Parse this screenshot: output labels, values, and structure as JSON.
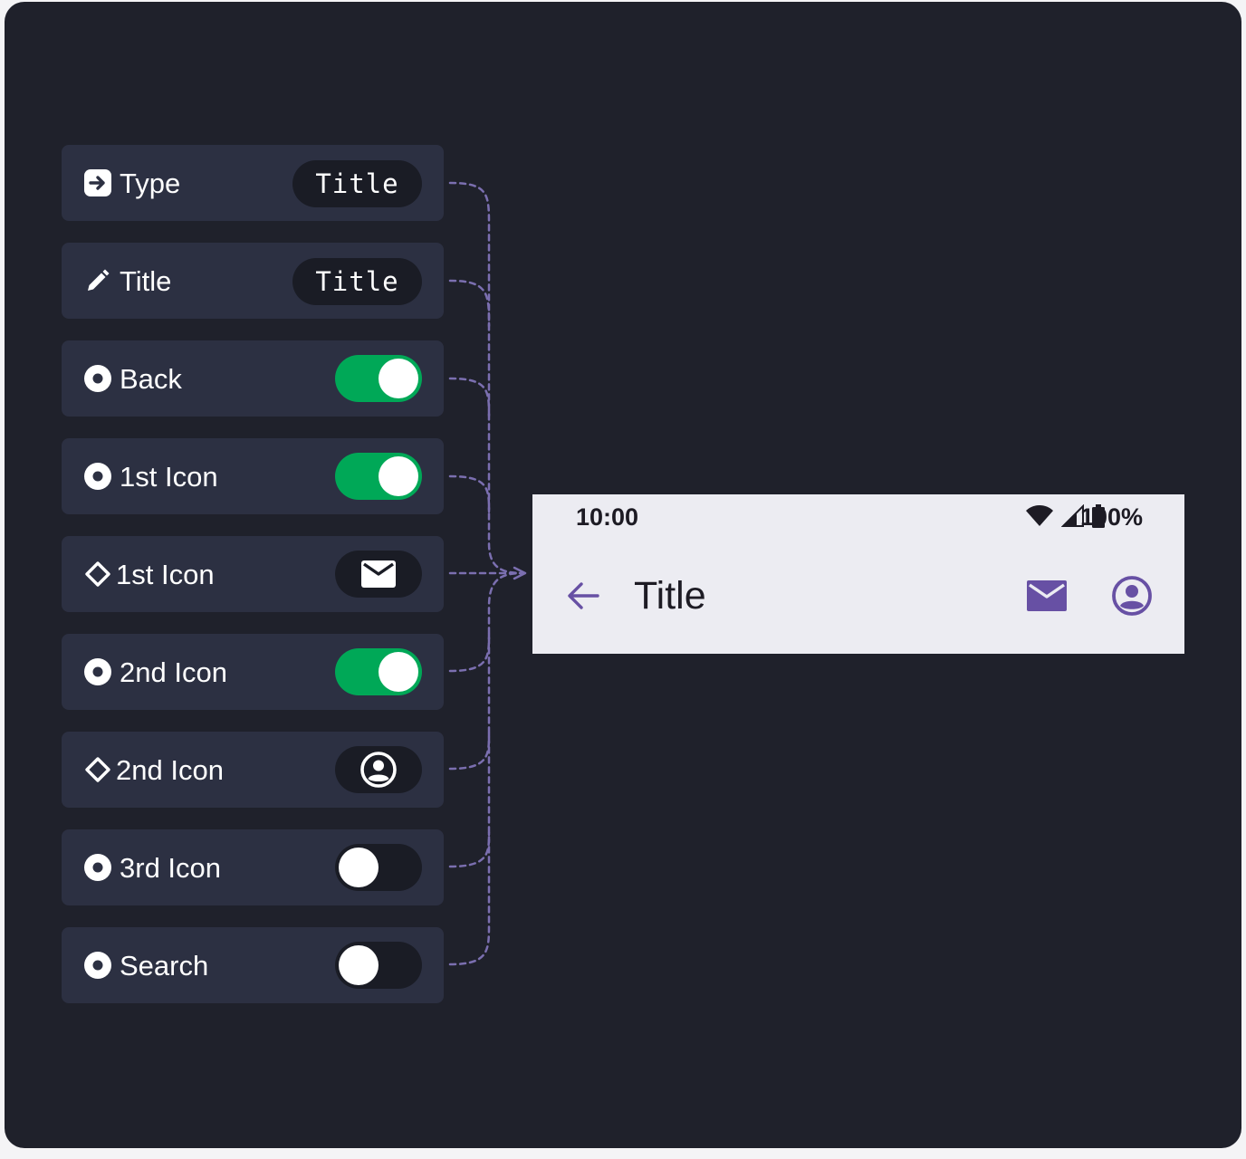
{
  "properties": [
    {
      "label": "Type",
      "kind": "text",
      "value": "Title",
      "icon": "variant-arrow-icon"
    },
    {
      "label": "Title",
      "kind": "text",
      "value": "Title",
      "icon": "pencil-icon"
    },
    {
      "label": "Back",
      "kind": "toggle",
      "on": true,
      "icon": "boolean-eye-icon"
    },
    {
      "label": "1st Icon",
      "kind": "toggle",
      "on": true,
      "icon": "boolean-eye-icon"
    },
    {
      "label": "1st Icon",
      "kind": "instance",
      "swap_icon": "mail-icon",
      "icon": "instance-diamond-icon"
    },
    {
      "label": "2nd Icon",
      "kind": "toggle",
      "on": true,
      "icon": "boolean-eye-icon"
    },
    {
      "label": "2nd Icon",
      "kind": "instance",
      "swap_icon": "account-circle-icon",
      "icon": "instance-diamond-icon"
    },
    {
      "label": "3rd Icon",
      "kind": "toggle",
      "on": false,
      "icon": "boolean-eye-icon"
    },
    {
      "label": "Search",
      "kind": "toggle",
      "on": false,
      "icon": "boolean-eye-icon"
    }
  ],
  "preview": {
    "status_bar": {
      "time": "10:00",
      "battery": "100%",
      "icons": [
        "wifi-icon",
        "cell-signal-icon",
        "battery-icon"
      ]
    },
    "app_bar": {
      "title": "Title",
      "leading_icon": "arrow-back-icon",
      "trailing_icons": [
        "mail-icon",
        "account-circle-icon"
      ]
    }
  },
  "colors": {
    "background": "#1f212b",
    "panel": "#2c3042",
    "pill": "#1a1c25",
    "toggle_on": "#00a857",
    "connector": "#7b6fb0",
    "preview_bg": "#ececf2",
    "accent": "#6750a4"
  }
}
